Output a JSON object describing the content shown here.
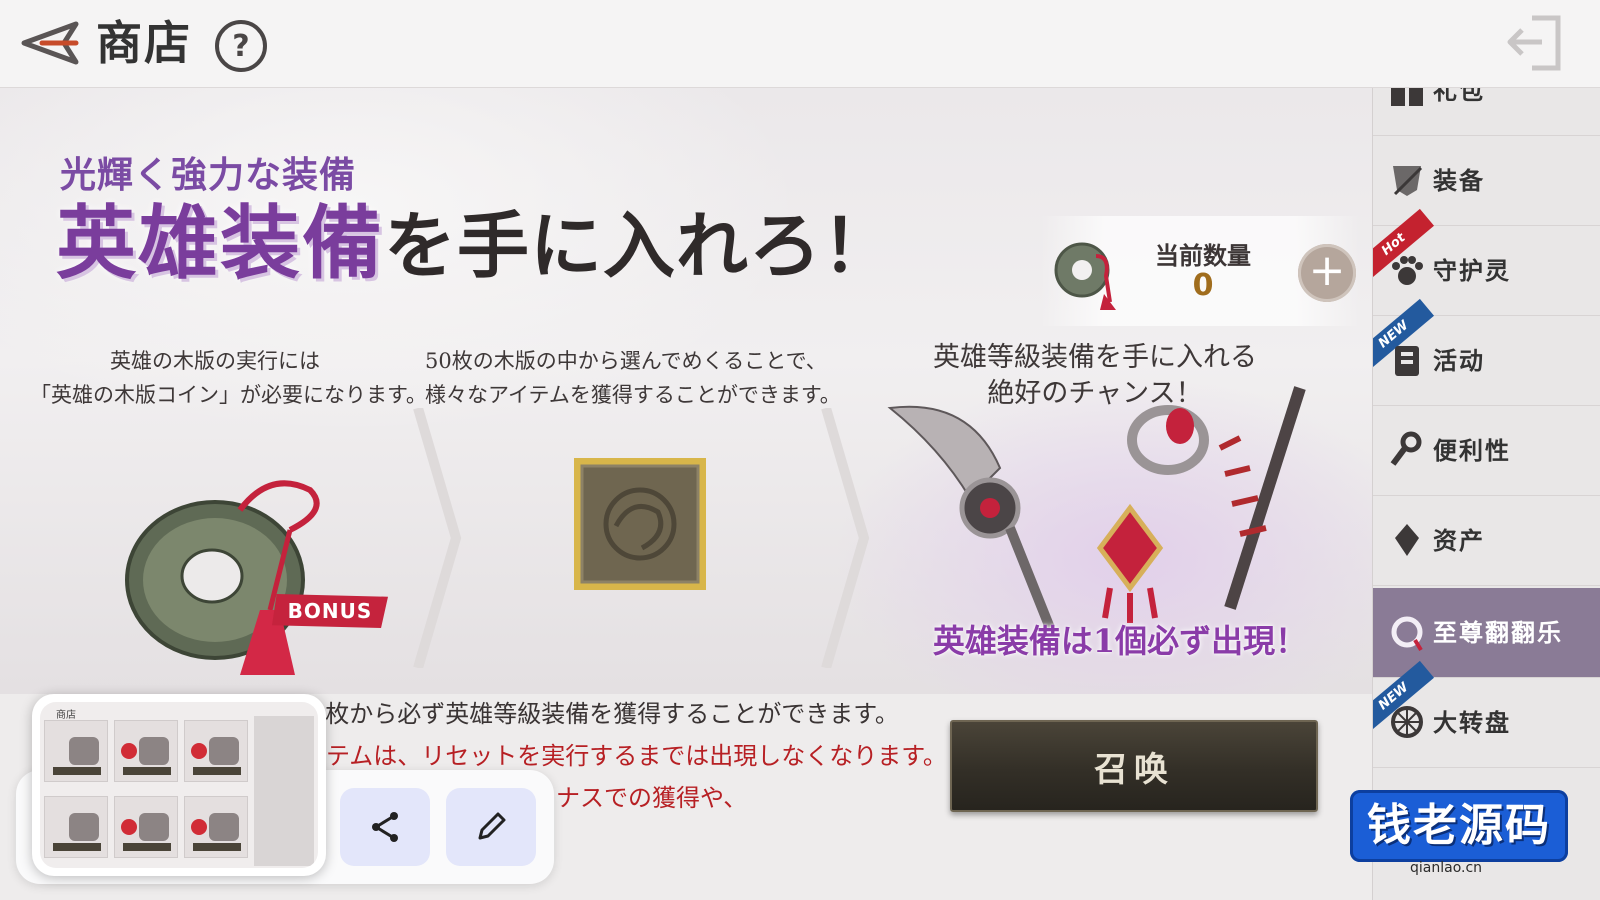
{
  "header": {
    "title": "商店",
    "help_label": "?"
  },
  "banner": {
    "subtitle": "光輝く強力な装備",
    "headline_main": "英雄装備",
    "headline_rest": "を手に入れろ！",
    "counter": {
      "label": "当前数量",
      "value": "0",
      "add_label": "+"
    },
    "steps": [
      {
        "line1": "英雄の木版の実行には",
        "line2": "「英雄の木版コイン」が必要になります。"
      },
      {
        "line1": "50枚の木版の中から選んでめくることで、",
        "line2": "様々なアイテムを獲得することができます。"
      },
      {
        "line1": "英雄等級装備を手に入れる",
        "line2": "絶好のチャンス！"
      }
    ],
    "bonus_label": "BONUS",
    "guarantee": "英雄装備は1個必ず出現！"
  },
  "notes": [
    "1枚から必ず英雄等級装備を獲得することができます。",
    "テムは、リセットを実行するまでは出現しなくなります。",
    "ナスでの獲得や、"
  ],
  "summon_label": "召唤",
  "sidebar": {
    "items": [
      {
        "label": "礼包",
        "icon": "gift-icon",
        "badge": ""
      },
      {
        "label": "装备",
        "icon": "armor-icon",
        "badge": ""
      },
      {
        "label": "守护灵",
        "icon": "paw-icon",
        "badge": "Hot"
      },
      {
        "label": "活动",
        "icon": "event-icon",
        "badge": "NEW"
      },
      {
        "label": "便利性",
        "icon": "wrench-icon",
        "badge": ""
      },
      {
        "label": "资产",
        "icon": "diamond-icon",
        "badge": ""
      },
      {
        "label": "至尊翻翻乐",
        "icon": "coin-icon",
        "badge": ""
      },
      {
        "label": "大转盘",
        "icon": "wheel-icon",
        "badge": "NEW"
      }
    ]
  },
  "screenshot_overlay": {
    "thumb_title": "商店"
  },
  "watermark": {
    "text": "钱老源码",
    "url": "qianlao.cn"
  },
  "colors": {
    "accent_purple": "#7a3d9c",
    "warning_red": "#b72024",
    "summon_dark": "#332f27",
    "active_tab": "#8a7b96"
  }
}
